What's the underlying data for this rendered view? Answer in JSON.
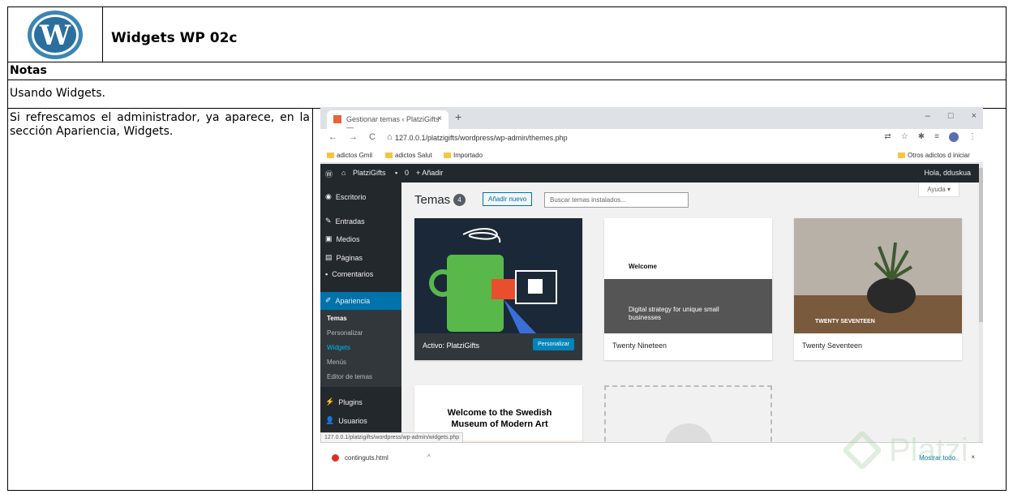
{
  "document": {
    "title": "Widgets WP 02c",
    "notes_heading": "Notas",
    "notes_text": "Usando Widgets.",
    "step_text": "Si refrescamos el administrador, ya aparece, en la sección Apariencia, Widgets."
  },
  "browser": {
    "tab_title": "Gestionar temas ‹ PlatziGifts — ",
    "tab_close": "×",
    "new_tab": "+",
    "window_controls": [
      "–",
      "□",
      "×"
    ],
    "nav": [
      "←",
      "→",
      "C",
      "⌂"
    ],
    "url": "127.0.0.1/platzigifts/wordpress/wp-admin/themes.php",
    "bookmarks": [
      "adictos Gmil",
      "adictos Salut",
      "Importado"
    ],
    "other_bookmarks": "Otros adictos d iniciar",
    "status_url": "127.0.0.1/platzigifts/wordpress/wp-admin/widgets.php",
    "download_file": "continguts.html",
    "show_all": "Mostrar todo",
    "download_close": "×"
  },
  "wp": {
    "site_name": "PlatziGifts",
    "comments_count": "0",
    "add_new": "+ Añadir",
    "greeting": "Hola, dduskua",
    "sidebar": [
      "Escritorio",
      "Entradas",
      "Medios",
      "Páginas",
      "Comentarios",
      "Apariencia",
      "Plugins",
      "Usuarios"
    ],
    "submenu": [
      "Temas",
      "Personalizar",
      "Widgets",
      "Menús",
      "Editor de temas"
    ],
    "page_title": "Temas",
    "theme_count": "4",
    "add_new_button": "Añadir nuevo",
    "search_placeholder": "Buscar temas instalados...",
    "help": "Ayuda ▾",
    "themes": [
      {
        "name": "Activo: PlatziGifts",
        "action": "Personalizar"
      },
      {
        "name": "Twenty Nineteen",
        "preview_heading": "Welcome",
        "preview_tagline": "Digital strategy for unique small businesses"
      },
      {
        "name": "Twenty Seventeen",
        "preview_label": "TWENTY SEVENTEEN"
      },
      {
        "preview_heading": "Welcome to the Swedish Museum of Modern Art"
      }
    ]
  },
  "watermark": "Platzi",
  "colors": {
    "wp_dark": "#23282d",
    "wp_blue": "#0073aa",
    "accent_green": "#a8cfa5"
  }
}
